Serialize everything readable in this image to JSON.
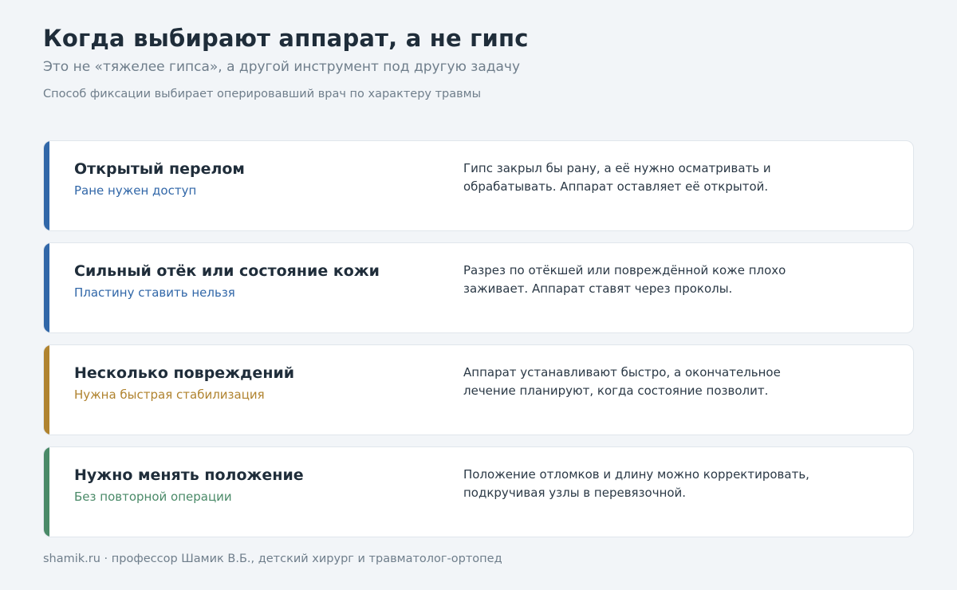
{
  "header": {
    "title": "Когда выбирают аппарат, а не гипс",
    "subtitle": "Это не «тяжелее гипса», а другой инструмент под другую задачу",
    "note": "Способ фиксации выбирает оперировавший врач по характеру травмы"
  },
  "cards": [
    {
      "title": "Открытый перелом",
      "tag": "Ране нужен доступ",
      "text": "Гипс закрыл бы рану, а её нужно осматривать и обрабатывать. Аппарат оставляет её открытой.",
      "accent": "#3167a8"
    },
    {
      "title": "Сильный отёк или состояние кожи",
      "tag": "Пластину ставить нельзя",
      "text": "Разрез по отёкшей или повреждённой коже плохо заживает. Аппарат ставят через проколы.",
      "accent": "#3167a8"
    },
    {
      "title": "Несколько повреждений",
      "tag": "Нужна быстрая стабилизация",
      "text": "Аппарат устанавливают быстро, а окончательное лечение планируют, когда состояние позволит.",
      "accent": "#b0832f"
    },
    {
      "title": "Нужно менять положение",
      "tag": "Без повторной операции",
      "text": "Положение отломков и длину можно корректировать, подкручивая узлы в перевязочной.",
      "accent": "#4a8a68"
    }
  ],
  "footer": {
    "text": "shamik.ru · профессор Шамик В.Б., детский хирург и травматолог-ортопед"
  }
}
